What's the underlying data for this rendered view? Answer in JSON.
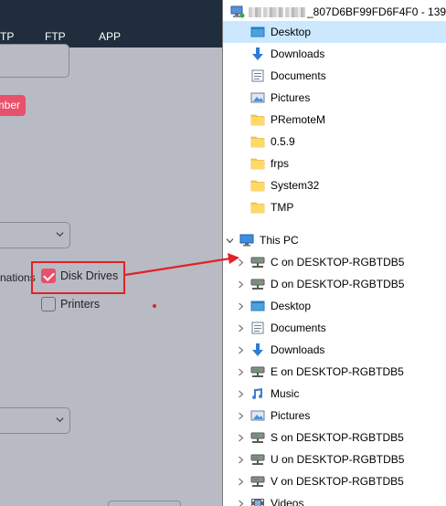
{
  "left_app": {
    "nav": {
      "tp": "TP",
      "ftp": "FTP",
      "app": "APP"
    },
    "pink_button": "mber",
    "nations_label": "nations",
    "disk_drives": {
      "label": "Disk Drives",
      "checked": true
    },
    "printers": {
      "label": "Printers",
      "checked": false
    },
    "accent_color": "#e8506b",
    "header_color": "#1f2d3d",
    "annotation_color": "#e42127"
  },
  "explorer": {
    "title": "_807D6BF99FD6F4F0 - 139",
    "quick_access": [
      {
        "label": "Desktop",
        "icon": "desktop-folder-icon",
        "selected": true
      },
      {
        "label": "Downloads",
        "icon": "download-arrow-icon"
      },
      {
        "label": "Documents",
        "icon": "documents-icon"
      },
      {
        "label": "Pictures",
        "icon": "pictures-icon"
      },
      {
        "label": "PRemoteM",
        "icon": "folder-icon"
      },
      {
        "label": "0.5.9",
        "icon": "folder-icon"
      },
      {
        "label": "frps",
        "icon": "folder-icon"
      },
      {
        "label": "System32",
        "icon": "folder-icon"
      },
      {
        "label": "TMP",
        "icon": "folder-icon"
      }
    ],
    "this_pc": {
      "label": "This PC",
      "icon": "monitor-icon"
    },
    "pc_items": [
      {
        "label": "C on DESKTOP-RGBTDB5",
        "icon": "network-drive-icon"
      },
      {
        "label": "D on DESKTOP-RGBTDB5",
        "icon": "network-drive-icon"
      },
      {
        "label": "Desktop",
        "icon": "desktop-folder-icon"
      },
      {
        "label": "Documents",
        "icon": "documents-icon"
      },
      {
        "label": "Downloads",
        "icon": "download-arrow-icon"
      },
      {
        "label": "E on DESKTOP-RGBTDB5",
        "icon": "network-drive-icon"
      },
      {
        "label": "Music",
        "icon": "music-icon"
      },
      {
        "label": "Pictures",
        "icon": "pictures-icon"
      },
      {
        "label": "S on DESKTOP-RGBTDB5",
        "icon": "network-drive-icon"
      },
      {
        "label": "U on DESKTOP-RGBTDB5",
        "icon": "network-drive-icon"
      },
      {
        "label": "V on DESKTOP-RGBTDB5",
        "icon": "network-drive-icon"
      },
      {
        "label": "Videos",
        "icon": "videos-icon"
      }
    ],
    "selected_color": "#cce8ff"
  }
}
